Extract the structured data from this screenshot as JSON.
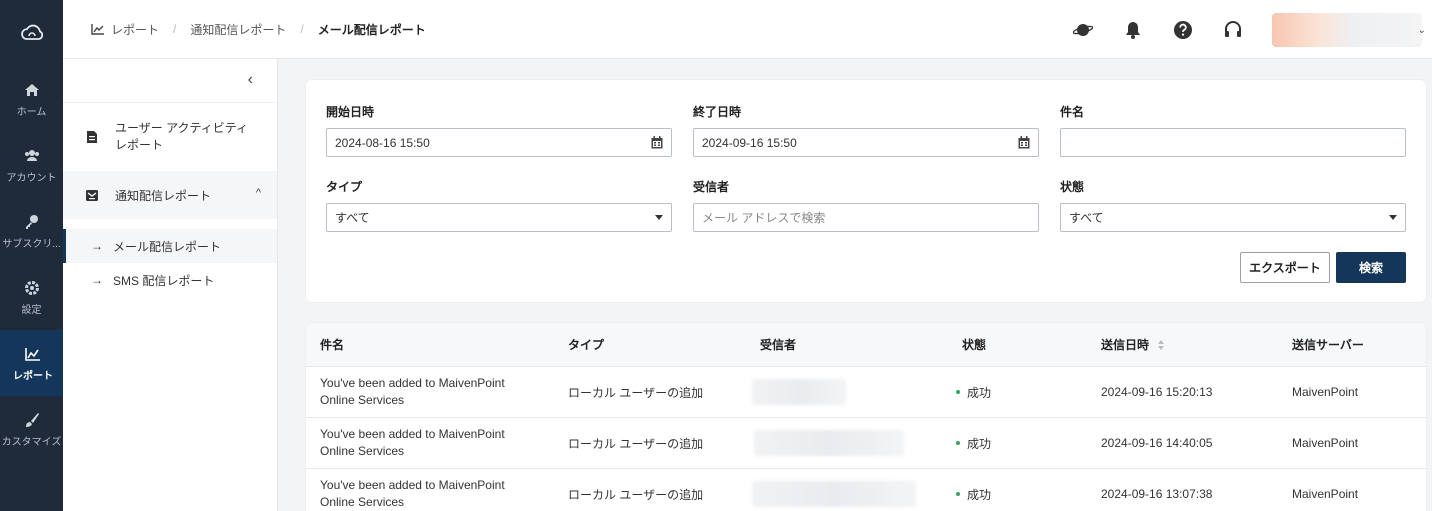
{
  "nav_rail": {
    "items": [
      {
        "label": "ホーム",
        "icon": "home-icon"
      },
      {
        "label": "アカウント",
        "icon": "users-icon"
      },
      {
        "label": "サブスクリ...",
        "icon": "key-icon"
      },
      {
        "label": "設定",
        "icon": "gear-icon"
      },
      {
        "label": "レポート",
        "icon": "chart-icon"
      },
      {
        "label": "カスタマイズ",
        "icon": "brush-icon"
      }
    ]
  },
  "breadcrumb": {
    "items": [
      "レポート",
      "通知配信レポート"
    ],
    "current": "メール配信レポート"
  },
  "subnav": {
    "collapse": "‹",
    "item_user_activity": "ユーザー アクティビティ レポート",
    "item_notification": "通知配信レポート",
    "sub_email": "メール配信レポート",
    "sub_sms": "SMS 配信レポート"
  },
  "filters": {
    "start_label": "開始日時",
    "start_value": "2024-08-16 15:50",
    "end_label": "終了日時",
    "end_value": "2024-09-16 15:50",
    "subject_label": "件名",
    "subject_value": "",
    "type_label": "タイプ",
    "type_value": "すべて",
    "recipient_label": "受信者",
    "recipient_placeholder": "メール アドレスで検索",
    "status_label": "状態",
    "status_value": "すべて",
    "export_label": "エクスポート",
    "search_label": "検索"
  },
  "table": {
    "headers": [
      "件名",
      "タイプ",
      "受信者",
      "状態",
      "送信日時",
      "送信サーバー"
    ],
    "rows": [
      {
        "subject_1": "You've been added to MaivenPoint",
        "subject_2": "Online Services",
        "type": "ローカル ユーザーの追加",
        "status": "成功",
        "sent": "2024-09-16 15:20:13",
        "server": "MaivenPoint"
      },
      {
        "subject_1": "You've been added to MaivenPoint",
        "subject_2": "Online Services",
        "type": "ローカル ユーザーの追加",
        "status": "成功",
        "sent": "2024-09-16 14:40:05",
        "server": "MaivenPoint"
      },
      {
        "subject_1": "You've been added to MaivenPoint",
        "subject_2": "Online Services",
        "type": "ローカル ユーザーの追加",
        "status": "成功",
        "sent": "2024-09-16 13:07:38",
        "server": "MaivenPoint"
      }
    ]
  },
  "colors": {
    "rail": "#1f2b3b",
    "accent": "#13365a",
    "success": "#3aa35c"
  }
}
